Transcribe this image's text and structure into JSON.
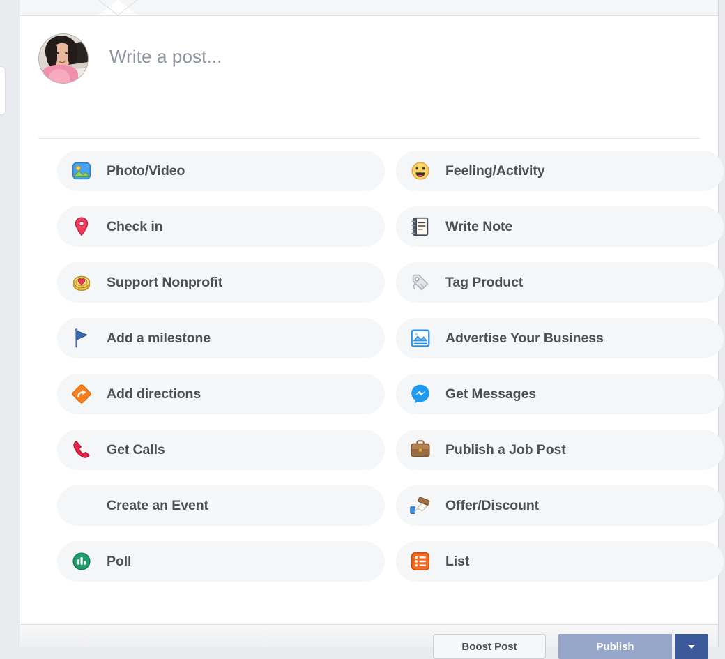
{
  "composer": {
    "placeholder": "Write a post...",
    "avatar_alt": "user-profile-photo",
    "options": [
      {
        "label": "Photo/Video",
        "icon": "photo-video-icon",
        "column": "left"
      },
      {
        "label": "Feeling/Activity",
        "icon": "smiley-face-icon",
        "column": "right"
      },
      {
        "label": "Check in",
        "icon": "location-pin-icon",
        "column": "left"
      },
      {
        "label": "Write Note",
        "icon": "notebook-icon",
        "column": "right"
      },
      {
        "label": "Support Nonprofit",
        "icon": "heart-coin-icon",
        "column": "left"
      },
      {
        "label": "Tag Product",
        "icon": "price-tag-icon",
        "column": "right"
      },
      {
        "label": "Add a milestone",
        "icon": "flag-icon",
        "column": "left"
      },
      {
        "label": "Advertise Your Business",
        "icon": "ad-picture-icon",
        "column": "right"
      },
      {
        "label": "Add directions",
        "icon": "directions-arrow-icon",
        "column": "left"
      },
      {
        "label": "Get Messages",
        "icon": "messenger-icon",
        "column": "right"
      },
      {
        "label": "Get Calls",
        "icon": "phone-handset-icon",
        "column": "left"
      },
      {
        "label": "Publish a Job Post",
        "icon": "briefcase-icon",
        "column": "right"
      },
      {
        "label": "Create an Event",
        "icon": "calendar-plus-icon",
        "column": "left"
      },
      {
        "label": "Offer/Discount",
        "icon": "offer-stamp-icon",
        "column": "right"
      },
      {
        "label": "Poll",
        "icon": "poll-bars-icon",
        "column": "left"
      },
      {
        "label": "List",
        "icon": "list-icon",
        "column": "right"
      }
    ]
  },
  "footer": {
    "boost_label": "Boost Post",
    "publish_label": "Publish",
    "publish_caret_icon": "chevron-down-icon"
  },
  "colors": {
    "page_background": "#e9ebee",
    "modal_background": "#ffffff",
    "row_background": "#f5f6f7",
    "label_text": "#4b4f56",
    "placeholder_text": "#8d949e",
    "publish_primary": "#95a6c8",
    "publish_caret": "#3b5998"
  }
}
